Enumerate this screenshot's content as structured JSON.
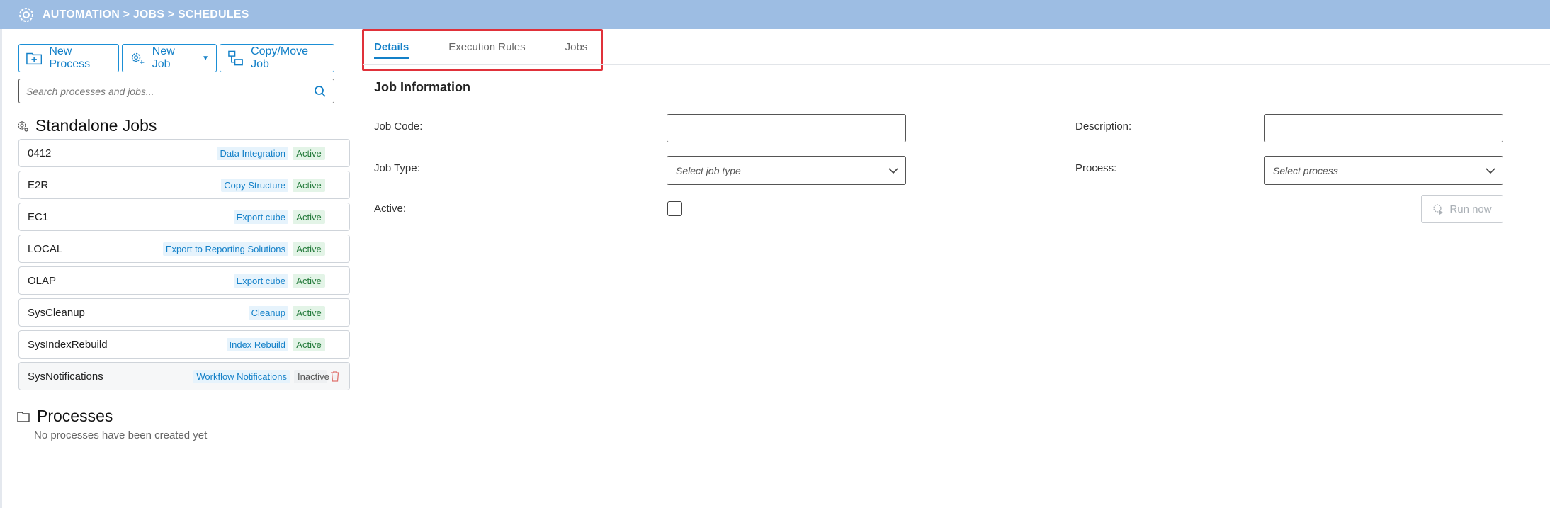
{
  "header": {
    "breadcrumb": "AUTOMATION > JOBS > SCHEDULES",
    "logo_icon": "gear-cluster-logo"
  },
  "toolbar": {
    "new_process_label": "New Process",
    "new_job_label": "New Job",
    "copy_move_label": "Copy/Move Job"
  },
  "search": {
    "placeholder": "Search processes and jobs...",
    "value": ""
  },
  "standalone": {
    "title": "Standalone Jobs",
    "jobs": [
      {
        "code": "0412",
        "type": "Data Integration",
        "status": "Active"
      },
      {
        "code": "E2R",
        "type": "Copy Structure",
        "status": "Active"
      },
      {
        "code": "EC1",
        "type": "Export cube",
        "status": "Active"
      },
      {
        "code": "LOCAL",
        "type": "Export to Reporting Solutions",
        "status": "Active"
      },
      {
        "code": "OLAP",
        "type": "Export cube",
        "status": "Active"
      },
      {
        "code": "SysCleanup",
        "type": "Cleanup",
        "status": "Active"
      },
      {
        "code": "SysIndexRebuild",
        "type": "Index Rebuild",
        "status": "Active"
      },
      {
        "code": "SysNotifications",
        "type": "Workflow Notifications",
        "status": "Inactive"
      }
    ]
  },
  "processes": {
    "title": "Processes",
    "empty_message": "No processes have been created yet"
  },
  "tabs": [
    {
      "label": "Details",
      "active": true
    },
    {
      "label": "Execution Rules",
      "active": false
    },
    {
      "label": "Jobs",
      "active": false
    }
  ],
  "form": {
    "section_title": "Job Information",
    "job_code_label": "Job Code:",
    "job_code_value": "",
    "description_label": "Description:",
    "description_value": "",
    "job_type_label": "Job Type:",
    "job_type_placeholder": "Select job type",
    "process_label": "Process:",
    "process_placeholder": "Select process",
    "active_label": "Active:",
    "active_checked": false,
    "run_now_label": "Run now"
  },
  "colors": {
    "header_bg": "#9dbde3",
    "accent": "#1380c8",
    "highlight": "#e0313a",
    "active_tag": "#e3f4e7"
  }
}
